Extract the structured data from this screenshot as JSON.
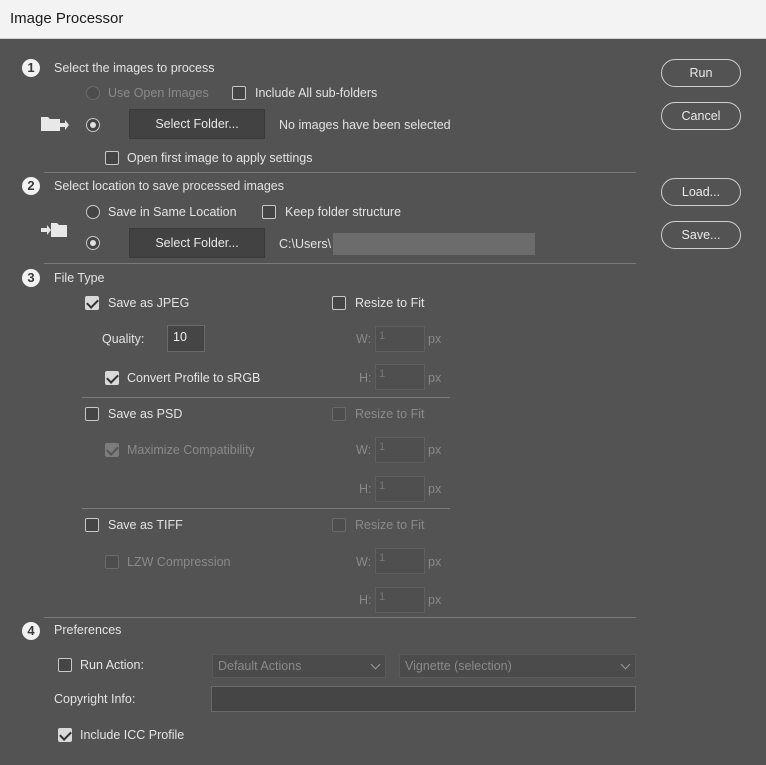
{
  "window": {
    "title": "Image Processor"
  },
  "section1": {
    "number": "1",
    "title": "Select the images to process",
    "use_open_images": "Use Open Images",
    "include_subfolders": "Include All sub-folders",
    "select_folder": "Select Folder...",
    "status": "No images have been selected",
    "open_first": "Open first image to apply settings"
  },
  "section2": {
    "number": "2",
    "title": "Select location to save processed images",
    "same_location": "Save in Same Location",
    "keep_structure": "Keep folder structure",
    "select_folder": "Select Folder...",
    "path": "C:\\Users\\"
  },
  "section3": {
    "number": "3",
    "title": "File Type",
    "jpeg": {
      "label": "Save as JPEG",
      "checked": true,
      "resize": "Resize to Fit",
      "quality_label": "Quality:",
      "quality_value": "10",
      "convert": "Convert Profile to sRGB",
      "w_label": "W:",
      "w_value": "1",
      "h_label": "H:",
      "h_value": "1",
      "unit": "px"
    },
    "psd": {
      "label": "Save as PSD",
      "resize": "Resize to Fit",
      "maximize": "Maximize Compatibility",
      "w_label": "W:",
      "w_value": "1",
      "h_label": "H:",
      "h_value": "1",
      "unit": "px"
    },
    "tiff": {
      "label": "Save as TIFF",
      "resize": "Resize to Fit",
      "lzw": "LZW Compression",
      "w_label": "W:",
      "w_value": "1",
      "h_label": "H:",
      "h_value": "1",
      "unit": "px"
    }
  },
  "section4": {
    "number": "4",
    "title": "Preferences",
    "run_action": "Run Action:",
    "action_set": "Default Actions",
    "action": "Vignette (selection)",
    "copyright_label": "Copyright Info:",
    "copyright_value": "",
    "icc": "Include ICC Profile"
  },
  "buttons": {
    "run": "Run",
    "cancel": "Cancel",
    "load": "Load...",
    "save": "Save..."
  },
  "colors": {
    "dialog_bg": "#535353",
    "titlebar_bg": "#f3f3f3"
  }
}
